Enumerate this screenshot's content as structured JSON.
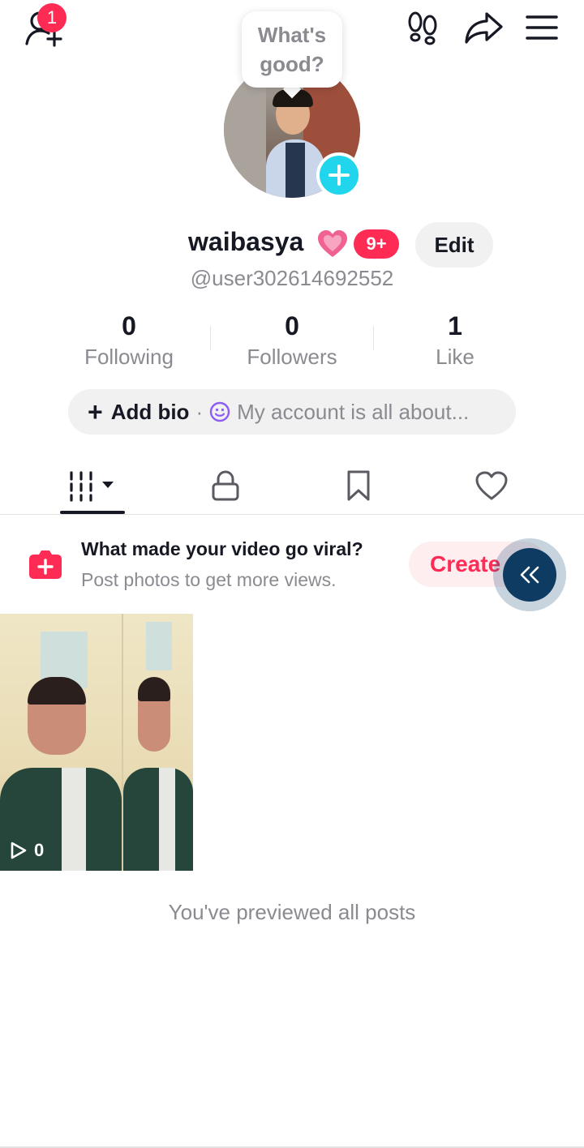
{
  "top_bar": {
    "friend_badge": "1"
  },
  "profile": {
    "bubble_text": "What's good?",
    "display_name": "waibasya",
    "name_badge": "9+",
    "edit_label": "Edit",
    "handle": "@user302614692552"
  },
  "stats": [
    {
      "value": "0",
      "label": "Following"
    },
    {
      "value": "0",
      "label": "Followers"
    },
    {
      "value": "1",
      "label": "Like"
    }
  ],
  "bio": {
    "add_label": "Add bio",
    "separator": "·",
    "placeholder": "My account is all about..."
  },
  "tabs": [
    "videos-grid-icon",
    "lock-icon",
    "bookmark-icon",
    "heart-icon"
  ],
  "promo": {
    "title": "What made your video go viral?",
    "subtitle": "Post photos to get more views.",
    "create_label": "Create"
  },
  "posts": [
    {
      "views": "0"
    }
  ],
  "end_text": "You've previewed all posts",
  "colors": {
    "accent": "#fe2c55",
    "cyan": "#20d5ec",
    "secondary_text": "#8a8b91",
    "chip_bg": "#f1f1f2"
  }
}
